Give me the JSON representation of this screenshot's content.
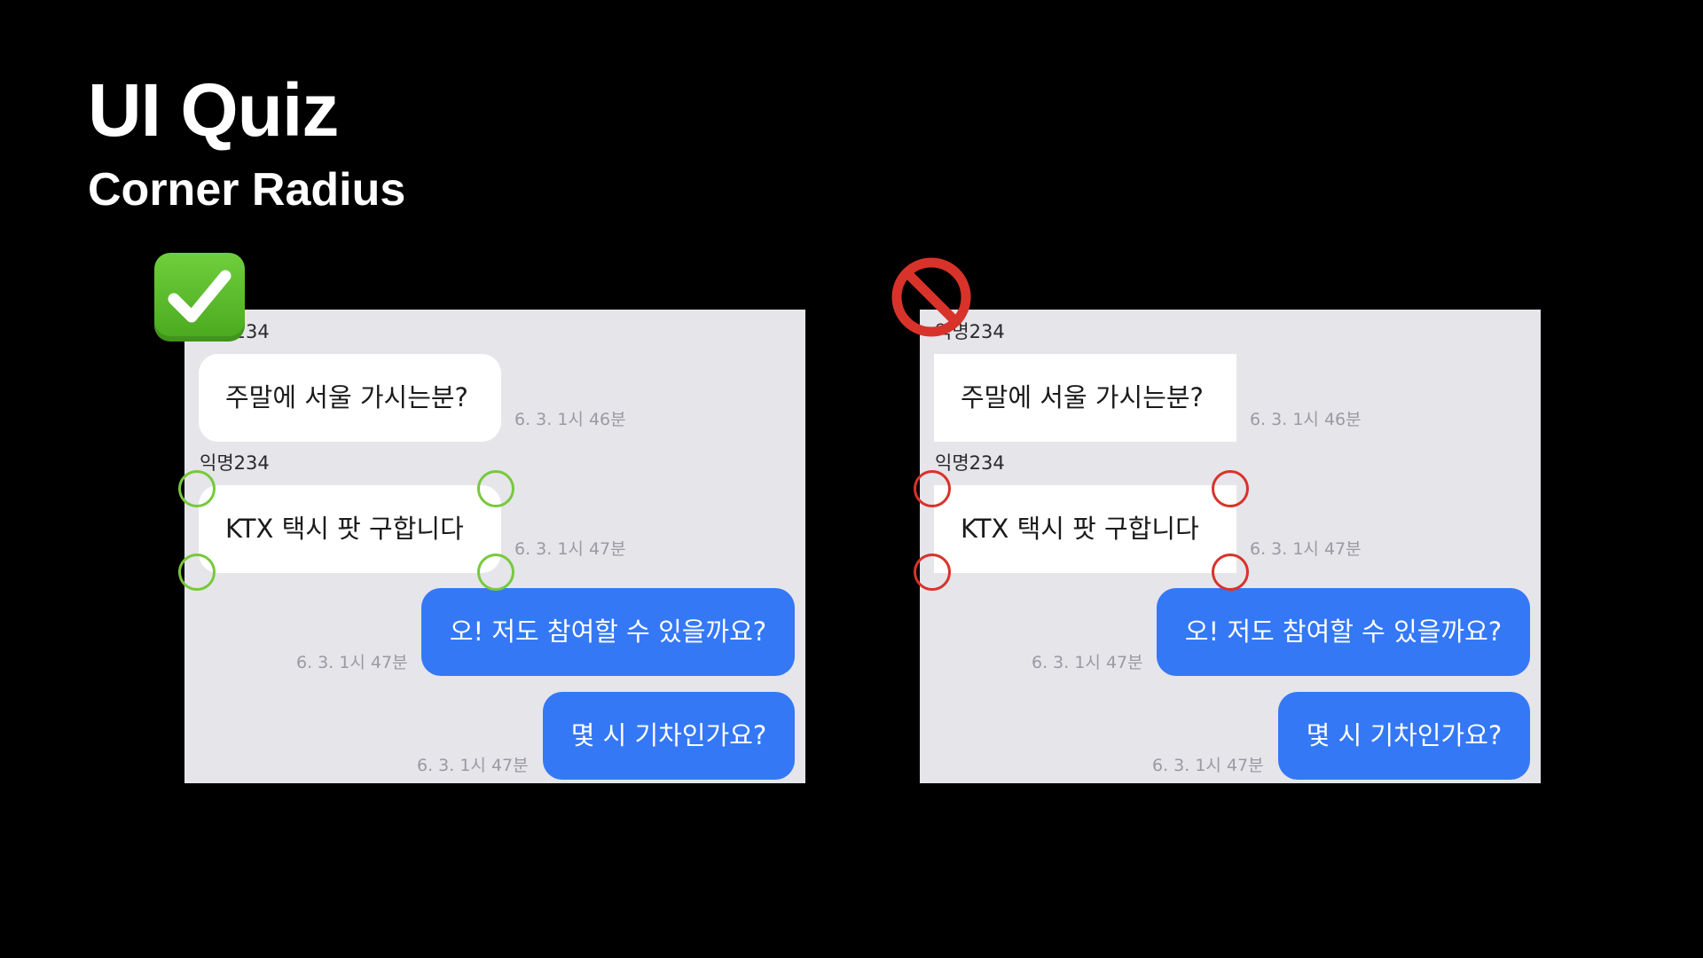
{
  "slide": {
    "title": "UI Quiz",
    "subtitle": "Corner Radius"
  },
  "colors": {
    "background": "#000000",
    "chat_background": "#e5e5ea",
    "incoming_bubble": "#ffffff",
    "outgoing_bubble": "#3478f6",
    "good_marker": "#78c93c",
    "bad_marker": "#d8332a"
  },
  "examples": [
    {
      "verdict_icon": "check-mark-icon",
      "sender_1": "익명234",
      "message_1": "주말에 서울 가시는분?",
      "time_1": "6. 3. 1시 46분",
      "sender_2": "익명234",
      "message_2": "KTX 택시 팟 구합니다",
      "time_2": "6. 3. 1시 47분",
      "reply_1": "오! 저도 참여할 수 있을까요?",
      "reply_time_1": "6. 3. 1시 47분",
      "reply_2": "몇 시 기차인가요?",
      "reply_time_2": "6. 3. 1시 47분"
    },
    {
      "verdict_icon": "prohibited-icon",
      "sender_1": "익명234",
      "message_1": "주말에 서울 가시는분?",
      "time_1": "6. 3. 1시 46분",
      "sender_2": "익명234",
      "message_2": "KTX 택시 팟 구합니다",
      "time_2": "6. 3. 1시 47분",
      "reply_1": "오! 저도 참여할 수 있을까요?",
      "reply_time_1": "6. 3. 1시 47분",
      "reply_2": "몇 시 기차인가요?",
      "reply_time_2": "6. 3. 1시 47분"
    }
  ]
}
